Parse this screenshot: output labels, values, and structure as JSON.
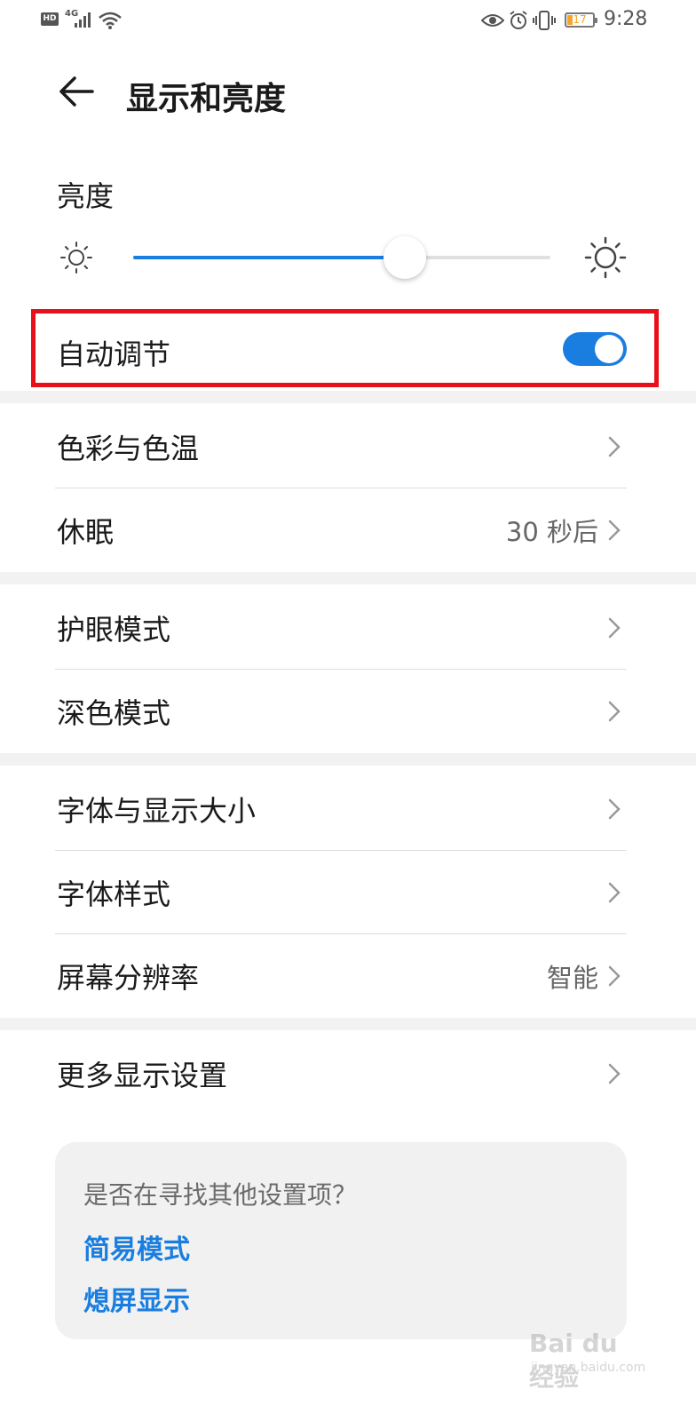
{
  "status_bar": {
    "hd": "HD",
    "network": "4G",
    "time": "9:28",
    "battery": "17",
    "battery_color": "#f4a52b",
    "icons": [
      "signal-icon",
      "wifi-icon",
      "eye-icon",
      "alarm-icon",
      "vibrate-icon",
      "battery-icon"
    ]
  },
  "header": {
    "title": "显示和亮度",
    "back_icon": "back-arrow-icon"
  },
  "brightness": {
    "label": "亮度",
    "level_fraction": 0.65,
    "min_icon": "sun-small-icon",
    "max_icon": "sun-large-icon"
  },
  "auto_adjust": {
    "label": "自动调节",
    "enabled": true
  },
  "groups": [
    {
      "items": [
        {
          "label": "色彩与色温",
          "value": ""
        },
        {
          "label": "休眠",
          "value": "30 秒后"
        }
      ]
    },
    {
      "items": [
        {
          "label": "护眼模式",
          "value": ""
        },
        {
          "label": "深色模式",
          "value": ""
        }
      ]
    },
    {
      "items": [
        {
          "label": "字体与显示大小",
          "value": ""
        },
        {
          "label": "字体样式",
          "value": ""
        },
        {
          "label": "屏幕分辨率",
          "value": "智能"
        }
      ]
    },
    {
      "items": [
        {
          "label": "更多显示设置",
          "value": ""
        }
      ]
    }
  ],
  "suggestions": {
    "question": "是否在寻找其他设置项？",
    "links": [
      "简易模式",
      "熄屏显示"
    ]
  },
  "watermark": {
    "brand": "Bai du 经验",
    "url": "jingyan.baidu.com"
  },
  "colors": {
    "accent": "#1a7ee0",
    "highlight_border": "#e8101a",
    "separator": "#f2f2f2"
  }
}
